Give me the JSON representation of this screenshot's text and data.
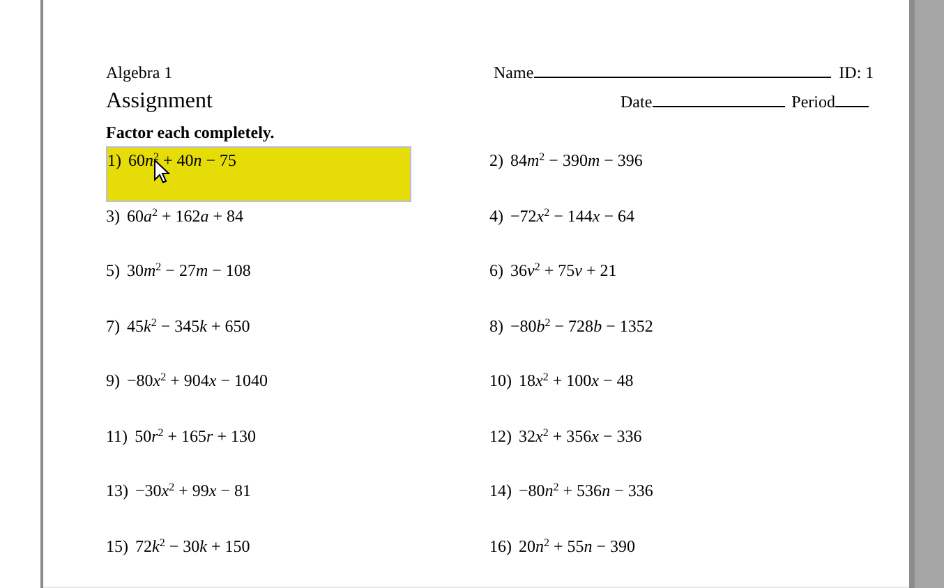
{
  "header": {
    "course": "Algebra 1",
    "name_label": "Name",
    "id_label": "ID: 1",
    "title": "Assignment",
    "date_label": "Date",
    "period_label": "Period"
  },
  "instructions": "Factor each completely.",
  "problems": [
    {
      "number": "1)",
      "selected": true,
      "parts": [
        {
          "kind": "num",
          "text": "60"
        },
        {
          "kind": "var",
          "text": "n"
        },
        {
          "kind": "sup",
          "text": "2"
        },
        {
          "kind": "num",
          "text": " + 40"
        },
        {
          "kind": "var",
          "text": "n"
        },
        {
          "kind": "num",
          "text": " − 75"
        }
      ]
    },
    {
      "number": "2)",
      "selected": false,
      "parts": [
        {
          "kind": "num",
          "text": "84"
        },
        {
          "kind": "var",
          "text": "m"
        },
        {
          "kind": "sup",
          "text": "2"
        },
        {
          "kind": "num",
          "text": " − 390"
        },
        {
          "kind": "var",
          "text": "m"
        },
        {
          "kind": "num",
          "text": " − 396"
        }
      ]
    },
    {
      "number": "3)",
      "selected": false,
      "parts": [
        {
          "kind": "num",
          "text": "60"
        },
        {
          "kind": "var",
          "text": "a"
        },
        {
          "kind": "sup",
          "text": "2"
        },
        {
          "kind": "num",
          "text": " + 162"
        },
        {
          "kind": "var",
          "text": "a"
        },
        {
          "kind": "num",
          "text": " + 84"
        }
      ]
    },
    {
      "number": "4)",
      "selected": false,
      "parts": [
        {
          "kind": "num",
          "text": "−72"
        },
        {
          "kind": "var",
          "text": "x"
        },
        {
          "kind": "sup",
          "text": "2"
        },
        {
          "kind": "num",
          "text": " − 144"
        },
        {
          "kind": "var",
          "text": "x"
        },
        {
          "kind": "num",
          "text": " − 64"
        }
      ]
    },
    {
      "number": "5)",
      "selected": false,
      "parts": [
        {
          "kind": "num",
          "text": "30"
        },
        {
          "kind": "var",
          "text": "m"
        },
        {
          "kind": "sup",
          "text": "2"
        },
        {
          "kind": "num",
          "text": " − 27"
        },
        {
          "kind": "var",
          "text": "m"
        },
        {
          "kind": "num",
          "text": " − 108"
        }
      ]
    },
    {
      "number": "6)",
      "selected": false,
      "parts": [
        {
          "kind": "num",
          "text": "36"
        },
        {
          "kind": "var",
          "text": "v"
        },
        {
          "kind": "sup",
          "text": "2"
        },
        {
          "kind": "num",
          "text": " + 75"
        },
        {
          "kind": "var",
          "text": "v"
        },
        {
          "kind": "num",
          "text": " + 21"
        }
      ]
    },
    {
      "number": "7)",
      "selected": false,
      "parts": [
        {
          "kind": "num",
          "text": "45"
        },
        {
          "kind": "var",
          "text": "k"
        },
        {
          "kind": "sup",
          "text": "2"
        },
        {
          "kind": "num",
          "text": " − 345"
        },
        {
          "kind": "var",
          "text": "k"
        },
        {
          "kind": "num",
          "text": " + 650"
        }
      ]
    },
    {
      "number": "8)",
      "selected": false,
      "parts": [
        {
          "kind": "num",
          "text": "−80"
        },
        {
          "kind": "var",
          "text": "b"
        },
        {
          "kind": "sup",
          "text": "2"
        },
        {
          "kind": "num",
          "text": " − 728"
        },
        {
          "kind": "var",
          "text": "b"
        },
        {
          "kind": "num",
          "text": " − 1352"
        }
      ]
    },
    {
      "number": "9)",
      "selected": false,
      "parts": [
        {
          "kind": "num",
          "text": "−80"
        },
        {
          "kind": "var",
          "text": "x"
        },
        {
          "kind": "sup",
          "text": "2"
        },
        {
          "kind": "num",
          "text": " + 904"
        },
        {
          "kind": "var",
          "text": "x"
        },
        {
          "kind": "num",
          "text": " − 1040"
        }
      ]
    },
    {
      "number": "10)",
      "selected": false,
      "parts": [
        {
          "kind": "num",
          "text": "18"
        },
        {
          "kind": "var",
          "text": "x"
        },
        {
          "kind": "sup",
          "text": "2"
        },
        {
          "kind": "num",
          "text": " + 100"
        },
        {
          "kind": "var",
          "text": "x"
        },
        {
          "kind": "num",
          "text": " − 48"
        }
      ]
    },
    {
      "number": "11)",
      "selected": false,
      "parts": [
        {
          "kind": "num",
          "text": "50"
        },
        {
          "kind": "var",
          "text": "r"
        },
        {
          "kind": "sup",
          "text": "2"
        },
        {
          "kind": "num",
          "text": " + 165"
        },
        {
          "kind": "var",
          "text": "r"
        },
        {
          "kind": "num",
          "text": " + 130"
        }
      ]
    },
    {
      "number": "12)",
      "selected": false,
      "parts": [
        {
          "kind": "num",
          "text": "32"
        },
        {
          "kind": "var",
          "text": "x"
        },
        {
          "kind": "sup",
          "text": "2"
        },
        {
          "kind": "num",
          "text": " + 356"
        },
        {
          "kind": "var",
          "text": "x"
        },
        {
          "kind": "num",
          "text": " − 336"
        }
      ]
    },
    {
      "number": "13)",
      "selected": false,
      "parts": [
        {
          "kind": "num",
          "text": "−30"
        },
        {
          "kind": "var",
          "text": "x"
        },
        {
          "kind": "sup",
          "text": "2"
        },
        {
          "kind": "num",
          "text": " + 99"
        },
        {
          "kind": "var",
          "text": "x"
        },
        {
          "kind": "num",
          "text": " − 81"
        }
      ]
    },
    {
      "number": "14)",
      "selected": false,
      "parts": [
        {
          "kind": "num",
          "text": "−80"
        },
        {
          "kind": "var",
          "text": "n"
        },
        {
          "kind": "sup",
          "text": "2"
        },
        {
          "kind": "num",
          "text": " + 536"
        },
        {
          "kind": "var",
          "text": "n"
        },
        {
          "kind": "num",
          "text": " − 336"
        }
      ]
    },
    {
      "number": "15)",
      "selected": false,
      "parts": [
        {
          "kind": "num",
          "text": "72"
        },
        {
          "kind": "var",
          "text": "k"
        },
        {
          "kind": "sup",
          "text": "2"
        },
        {
          "kind": "num",
          "text": " − 30"
        },
        {
          "kind": "var",
          "text": "k"
        },
        {
          "kind": "num",
          "text": " + 150"
        }
      ]
    },
    {
      "number": "16)",
      "selected": false,
      "parts": [
        {
          "kind": "num",
          "text": "20"
        },
        {
          "kind": "var",
          "text": "n"
        },
        {
          "kind": "sup",
          "text": "2"
        },
        {
          "kind": "num",
          "text": " + 55"
        },
        {
          "kind": "var",
          "text": "n"
        },
        {
          "kind": "num",
          "text": " − 390"
        }
      ]
    }
  ]
}
